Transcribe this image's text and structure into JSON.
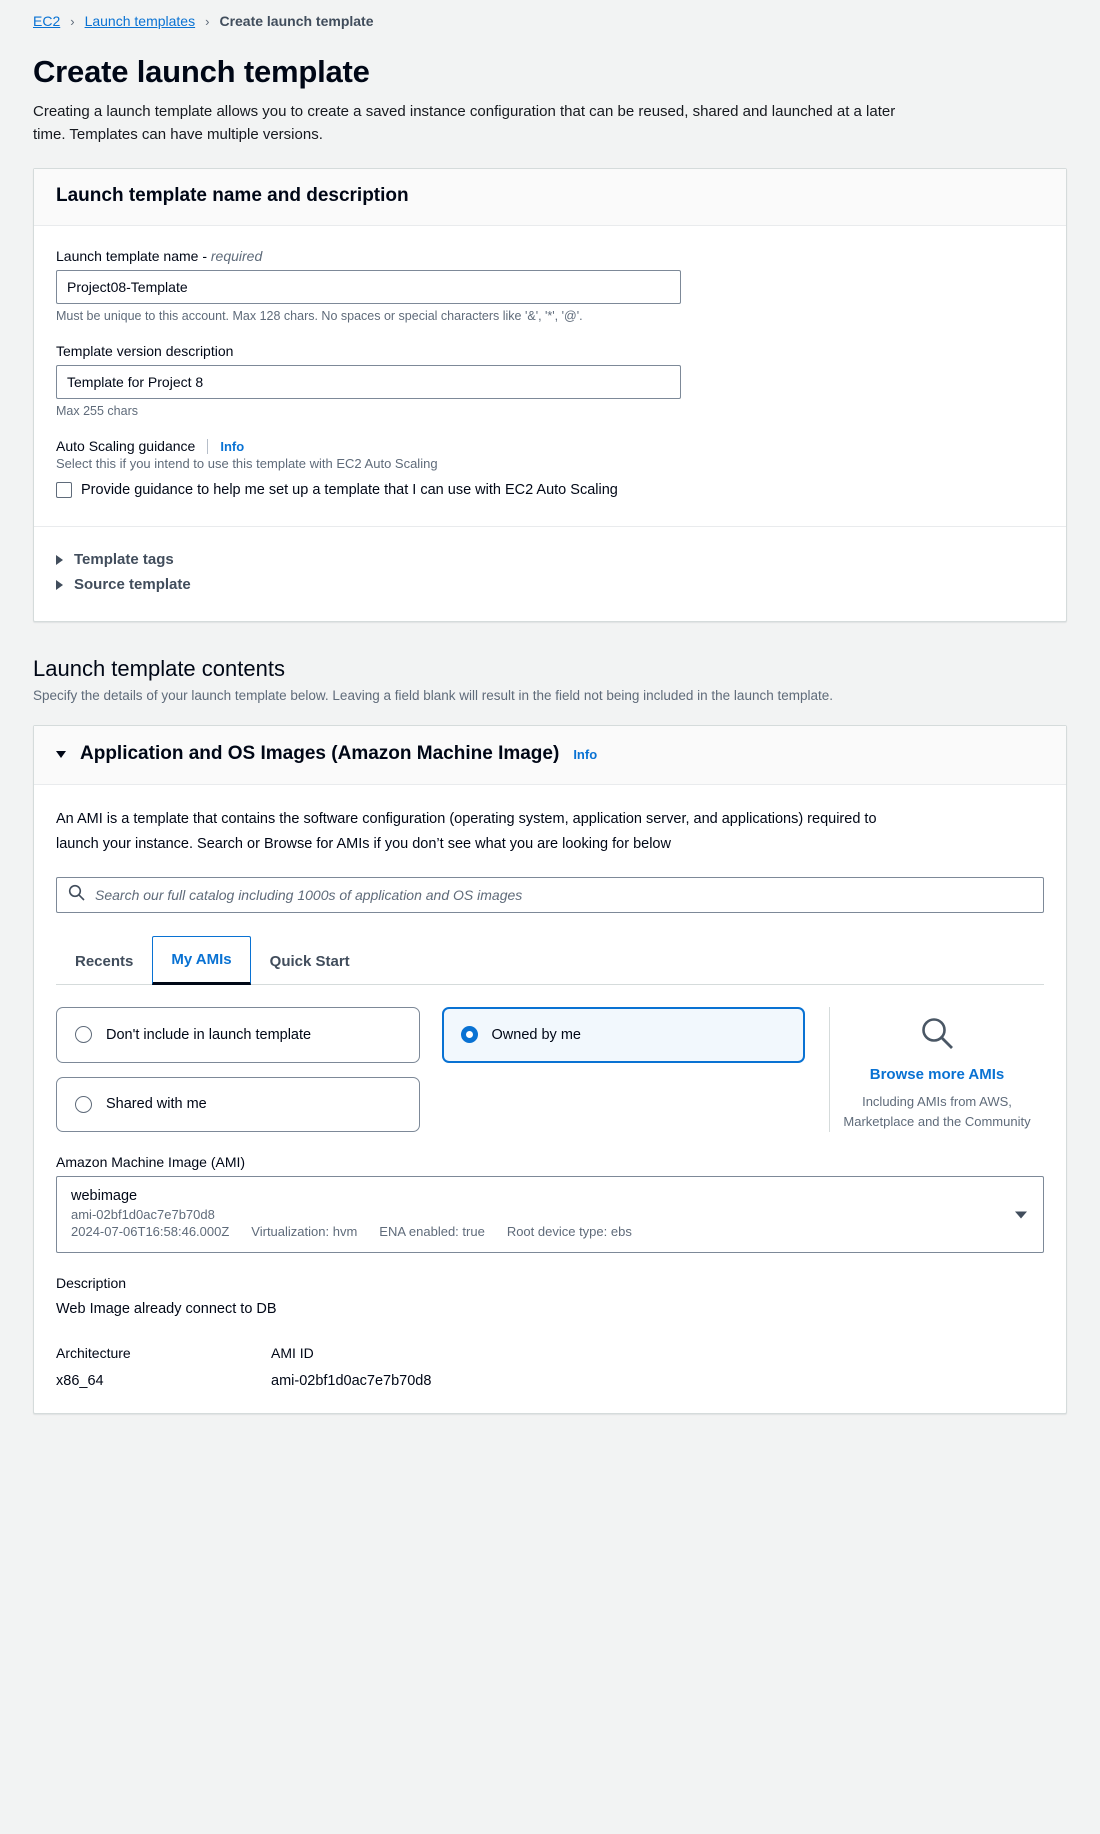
{
  "breadcrumb": {
    "root": "EC2",
    "parent": "Launch templates",
    "current": "Create launch template",
    "separator": "›"
  },
  "page": {
    "title": "Create launch template",
    "description": "Creating a launch template allows you to create a saved instance configuration that can be reused, shared and launched at a later time. Templates can have multiple versions."
  },
  "name_card": {
    "heading": "Launch template name and description",
    "name_label": "Launch template name - ",
    "name_label_required": "required",
    "name_value": "Project08-Template",
    "name_hint": "Must be unique to this account. Max 128 chars. No spaces or special characters like '&', '*', '@'.",
    "version_label": "Template version description",
    "version_value": "Template for Project 8",
    "version_hint": "Max 255 chars",
    "autoscaling_label": "Auto Scaling guidance",
    "autoscaling_info": "Info",
    "autoscaling_sub": "Select this if you intend to use this template with EC2 Auto Scaling",
    "autoscaling_checkbox_label": "Provide guidance to help me set up a template that I can use with EC2 Auto Scaling",
    "autoscaling_checked": false,
    "template_tags": "Template tags",
    "source_template": "Source template"
  },
  "contents": {
    "heading": "Launch template contents",
    "description": "Specify the details of your launch template below. Leaving a field blank will result in the field not being included in the launch template."
  },
  "ami_section": {
    "heading": "Application and OS Images (Amazon Machine Image)",
    "info": "Info",
    "description": "An AMI is a template that contains the software configuration (operating system, application server, and applications) required to launch your instance. Search or Browse for AMIs if you don’t see what you are looking for below",
    "search_placeholder": "Search our full catalog including 1000s of application and OS images",
    "search_value": "",
    "tabs": [
      {
        "label": "Recents",
        "active": false
      },
      {
        "label": "My AMIs",
        "active": true
      },
      {
        "label": "Quick Start",
        "active": false
      }
    ],
    "options": [
      {
        "label": "Don't include in launch template",
        "selected": false
      },
      {
        "label": "Owned by me",
        "selected": true
      },
      {
        "label": "Shared with me",
        "selected": false
      }
    ],
    "browse": {
      "link": "Browse more AMIs",
      "sub": "Including AMIs from AWS, Marketplace and the Community"
    },
    "ami_select": {
      "label": "Amazon Machine Image (AMI)",
      "name": "webimage",
      "id": "ami-02bf1d0ac7e7b70d8",
      "date": "2024-07-06T16:58:46.000Z",
      "virtualization": "Virtualization: hvm",
      "ena": "ENA enabled: true",
      "root_device": "Root device type: ebs"
    },
    "description_label": "Description",
    "description_value": "Web Image already connect to DB",
    "attributes": [
      {
        "key": "Architecture",
        "value": "x86_64"
      },
      {
        "key": "AMI ID",
        "value": "ami-02bf1d0ac7e7b70d8"
      }
    ]
  },
  "colors": {
    "accent": "#0972d3",
    "page_bg": "#f2f3f3",
    "border": "#d5dbdb",
    "muted": "#5f6b7a"
  }
}
